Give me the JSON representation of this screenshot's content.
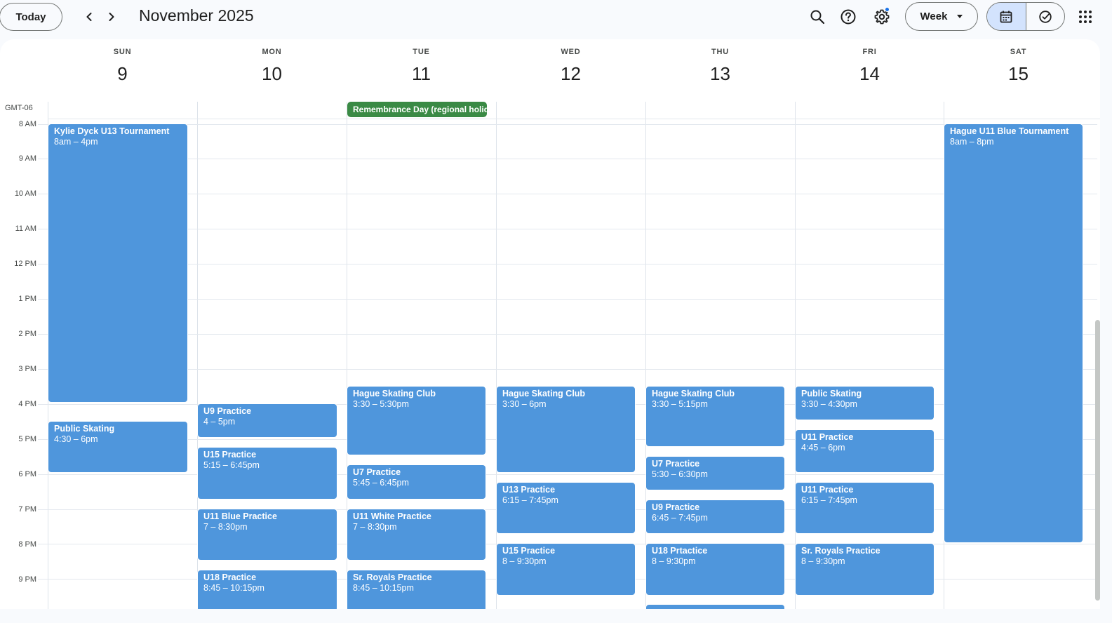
{
  "toolbar": {
    "today_label": "Today",
    "month_title": "November 2025",
    "view_label": "Week"
  },
  "grid": {
    "timezone": "GMT-06",
    "days": [
      {
        "name": "SUN",
        "num": "9"
      },
      {
        "name": "MON",
        "num": "10"
      },
      {
        "name": "TUE",
        "num": "11"
      },
      {
        "name": "WED",
        "num": "12"
      },
      {
        "name": "THU",
        "num": "13"
      },
      {
        "name": "FRI",
        "num": "14"
      },
      {
        "name": "SAT",
        "num": "15"
      }
    ],
    "hours": [
      "8 AM",
      "9 AM",
      "10 AM",
      "11 AM",
      "12 PM",
      "1 PM",
      "2 PM",
      "3 PM",
      "4 PM",
      "5 PM",
      "6 PM",
      "7 PM",
      "8 PM",
      "9 PM"
    ]
  },
  "allday": {
    "tue": "Remembrance Day (regional holiday)"
  },
  "events": {
    "sun": [
      {
        "title": "Kylie Dyck U13 Tournament",
        "time": "8am – 4pm"
      },
      {
        "title": "Public Skating",
        "time": "4:30 – 6pm"
      }
    ],
    "mon": [
      {
        "title": "U9 Practice",
        "time": "4 – 5pm"
      },
      {
        "title": "U15 Practice",
        "time": "5:15 – 6:45pm"
      },
      {
        "title": "U11 Blue Practice",
        "time": "7 – 8:30pm"
      },
      {
        "title": "U18 Practice",
        "time": "8:45 – 10:15pm"
      }
    ],
    "tue": [
      {
        "title": "Hague Skating Club",
        "time": "3:30 – 5:30pm"
      },
      {
        "title": "U7 Practice",
        "time": "5:45 – 6:45pm"
      },
      {
        "title": "U11 White Practice",
        "time": "7 – 8:30pm"
      },
      {
        "title": "Sr. Royals Practice",
        "time": "8:45 – 10:15pm"
      }
    ],
    "wed": [
      {
        "title": "Hague Skating Club",
        "time": "3:30 – 6pm"
      },
      {
        "title": "U13 Practice",
        "time": "6:15 – 7:45pm"
      },
      {
        "title": "U15 Practice",
        "time": "8 – 9:30pm"
      }
    ],
    "thu": [
      {
        "title": "Hague Skating Club",
        "time": "3:30 – 5:15pm"
      },
      {
        "title": "U7 Practice",
        "time": "5:30 – 6:30pm"
      },
      {
        "title": "U9 Practice",
        "time": "6:45 – 7:45pm"
      },
      {
        "title": "U18 Prtactice",
        "time": "8 – 9:30pm"
      }
    ],
    "fri": [
      {
        "title": "Public Skating",
        "time": "3:30 – 4:30pm"
      },
      {
        "title": "U11 Practice",
        "time": "4:45 – 6pm"
      },
      {
        "title": "U11 Practice",
        "time": "6:15 – 7:45pm"
      },
      {
        "title": "Sr. Royals Practice",
        "time": "8 – 9:30pm"
      }
    ],
    "sat": [
      {
        "title": "Hague U11 Blue Tournament",
        "time": "8am – 8pm"
      }
    ]
  },
  "colors": {
    "event": "#4f96dc",
    "holiday": "#3a8a45",
    "accent": "#1a73e8"
  }
}
